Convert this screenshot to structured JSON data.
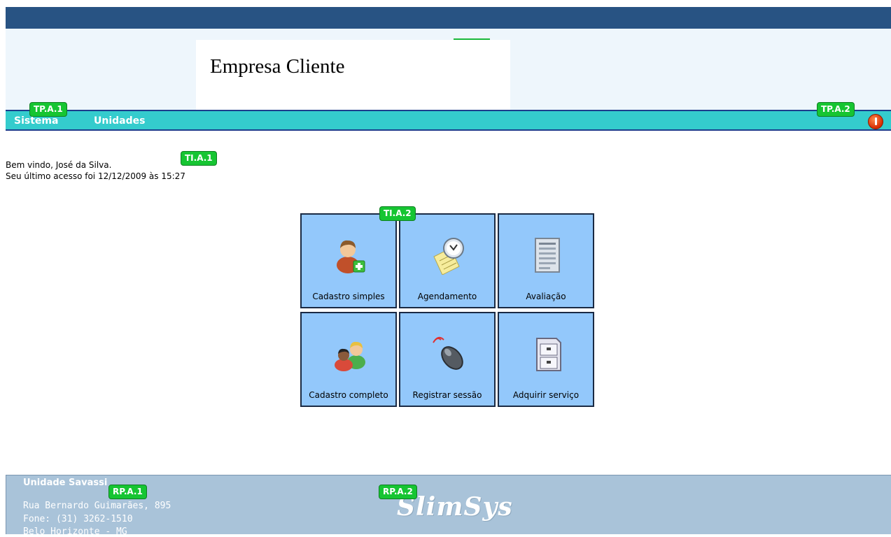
{
  "header": {
    "company_name": "Empresa Cliente"
  },
  "menu": {
    "items": [
      {
        "label": "Sistema"
      },
      {
        "label": "Unidades"
      }
    ],
    "logout_icon": "power-icon"
  },
  "tags": {
    "tp_a1": "TP.A.1",
    "tp_a2": "TP.A.2",
    "ti_a1": "TI.A.1",
    "ti_a2": "TI.A.2",
    "rp_a1": "RP.A.1",
    "rp_a2": "RP.A.2"
  },
  "welcome": {
    "line1": "Bem vindo, José da Silva.",
    "line2": "Seu último acesso foi 12/12/2009 às 15:27"
  },
  "tiles": [
    {
      "label": "Cadastro simples",
      "icon": "add-user-icon"
    },
    {
      "label": "Agendamento",
      "icon": "clock-notepad-icon"
    },
    {
      "label": "Avaliação",
      "icon": "document-list-icon"
    },
    {
      "label": "Cadastro completo",
      "icon": "group-users-icon"
    },
    {
      "label": "Registrar sessão",
      "icon": "mouse-icon"
    },
    {
      "label": "Adquirir serviço",
      "icon": "filing-cabinet-icon"
    }
  ],
  "footer": {
    "unit_name": "Unidade Savassi",
    "address": "Rua Bernardo Guimarães, 895",
    "phone": "Fone: (31) 3262-1510",
    "city": "Belo Horizonte - MG",
    "logo_text": "SlimSys"
  },
  "colors": {
    "topbar": "#285383",
    "menubar": "#34cccd",
    "tile": "#93c8fb",
    "footer": "#a9c3d9",
    "tag": "#16c532"
  }
}
